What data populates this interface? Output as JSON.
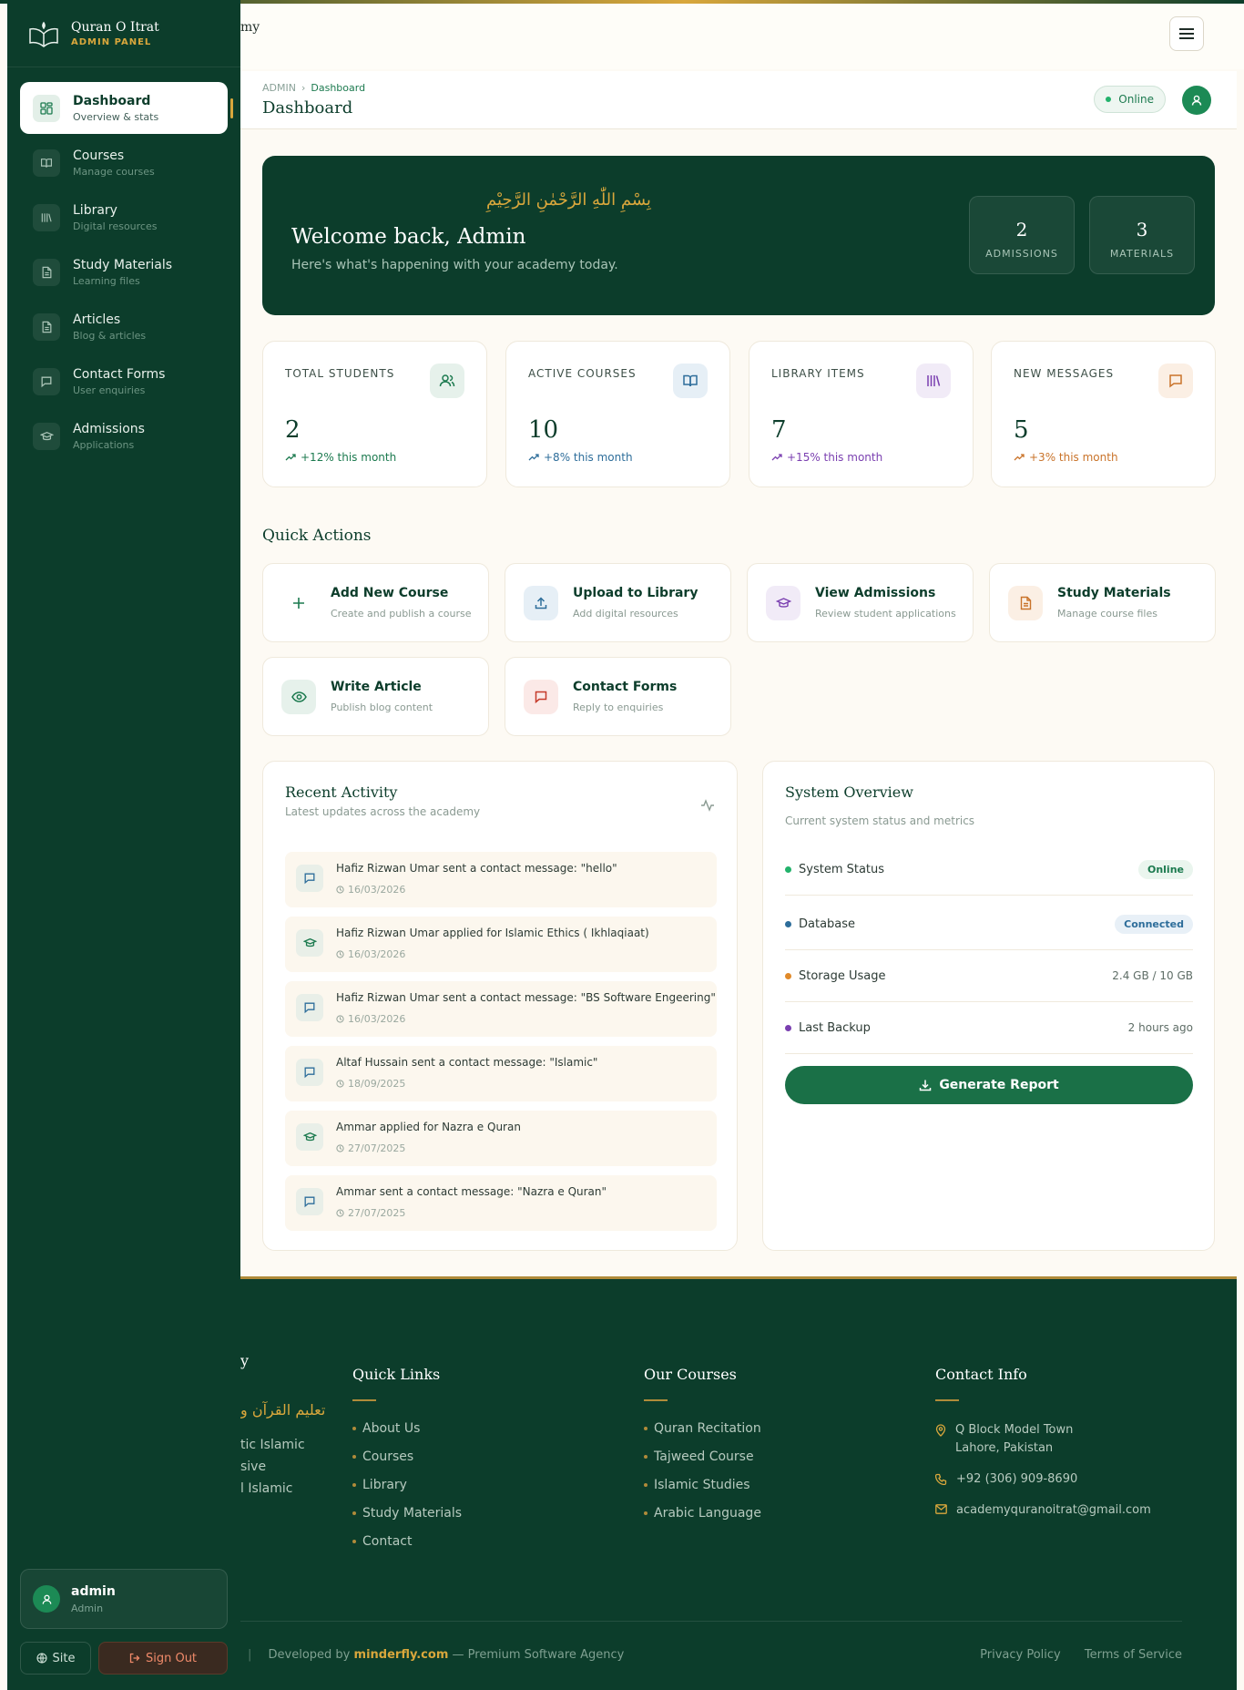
{
  "brand": {
    "name": "Quran O Itrat",
    "sub": "ADMIN PANEL"
  },
  "topbar": {
    "fragment": "my"
  },
  "sidebar": {
    "items": [
      {
        "title": "Dashboard",
        "sub": "Overview & stats",
        "icon": "grid-icon"
      },
      {
        "title": "Courses",
        "sub": "Manage courses",
        "icon": "book-icon"
      },
      {
        "title": "Library",
        "sub": "Digital resources",
        "icon": "library-icon"
      },
      {
        "title": "Study Materials",
        "sub": "Learning files",
        "icon": "file-icon"
      },
      {
        "title": "Articles",
        "sub": "Blog & articles",
        "icon": "file-icon"
      },
      {
        "title": "Contact Forms",
        "sub": "User enquiries",
        "icon": "message-icon"
      },
      {
        "title": "Admissions",
        "sub": "Applications",
        "icon": "graduation-cap-icon"
      }
    ],
    "user": {
      "name": "admin",
      "role": "Admin"
    },
    "site_label": "Site",
    "signout_label": "Sign Out"
  },
  "header": {
    "crumb_root": "ADMIN",
    "crumb_current": "Dashboard",
    "title": "Dashboard",
    "status": "Online"
  },
  "welcome": {
    "arabic": "بِسْمِ اللّٰهِ الرَّحْمٰنِ الرَّحِيْمِ",
    "title": "Welcome back, Admin",
    "subtitle": "Here's what's happening with your academy today.",
    "stats": [
      {
        "value": "2",
        "label": "ADMISSIONS"
      },
      {
        "value": "3",
        "label": "MATERIALS"
      }
    ]
  },
  "stats": [
    {
      "label": "TOTAL STUDENTS",
      "value": "2",
      "trend": "+12% this month",
      "color": "#1c7a4f",
      "bg": "#e6f1eb",
      "icon": "users-icon"
    },
    {
      "label": "ACTIVE COURSES",
      "value": "10",
      "trend": "+8% this month",
      "color": "#2d6d9a",
      "bg": "#e6eff6",
      "icon": "book-icon"
    },
    {
      "label": "LIBRARY ITEMS",
      "value": "7",
      "trend": "+15% this month",
      "color": "#7a3fb0",
      "bg": "#f1ebf7",
      "icon": "library-icon"
    },
    {
      "label": "NEW MESSAGES",
      "value": "5",
      "trend": "+3% this month",
      "color": "#c9732a",
      "bg": "#fbefe4",
      "icon": "message-icon"
    }
  ],
  "quick_actions_title": "Quick Actions",
  "quick_actions": [
    {
      "title": "Add New Course",
      "sub": "Create and publish a course",
      "icon": "plus-icon"
    },
    {
      "title": "Upload to Library",
      "sub": "Add digital resources",
      "icon": "upload-icon"
    },
    {
      "title": "View Admissions",
      "sub": "Review student applications",
      "icon": "graduation-cap-icon"
    },
    {
      "title": "Study Materials",
      "sub": "Manage course files",
      "icon": "file-icon"
    },
    {
      "title": "Write Article",
      "sub": "Publish blog content",
      "icon": "eye-icon"
    },
    {
      "title": "Contact Forms",
      "sub": "Reply to enquiries",
      "icon": "message-icon"
    }
  ],
  "activity": {
    "title": "Recent Activity",
    "subtitle": "Latest updates across the academy",
    "items": [
      {
        "text": "Hafiz Rizwan Umar sent a contact message: \"hello\"",
        "date": "16/03/2026",
        "icon": "message-icon"
      },
      {
        "text": "Hafiz Rizwan Umar applied for Islamic Ethics ( Ikhlaqiaat)",
        "date": "16/03/2026",
        "icon": "graduation-cap-icon"
      },
      {
        "text": "Hafiz Rizwan Umar sent a contact message: \"BS Software Engeering\"",
        "date": "16/03/2026",
        "icon": "message-icon"
      },
      {
        "text": "Altaf Hussain sent a contact message: \"Islamic\"",
        "date": "18/09/2025",
        "icon": "message-icon"
      },
      {
        "text": "Ammar applied for Nazra e Quran",
        "date": "27/07/2025",
        "icon": "graduation-cap-icon"
      },
      {
        "text": "Ammar sent a contact message: \"Nazra e Quran\"",
        "date": "27/07/2025",
        "icon": "message-icon"
      }
    ]
  },
  "system": {
    "title": "System Overview",
    "subtitle": "Current system status and metrics",
    "rows": [
      {
        "label": "System Status",
        "value": "Online",
        "dot": "#22b26b",
        "badge_color": "#1c7a4f",
        "badge_bg": "#eaf5ee"
      },
      {
        "label": "Database",
        "value": "Connected",
        "dot": "#2d6d9a",
        "badge_color": "#2d6d9a",
        "badge_bg": "#e8f0f7"
      },
      {
        "label": "Storage Usage",
        "value": "2.4 GB / 10 GB",
        "dot": "#e08a2a"
      },
      {
        "label": "Last Backup",
        "value": "2 hours ago",
        "dot": "#7a3fb0"
      }
    ],
    "button": "Generate Report"
  },
  "footer": {
    "brand_fragment": "y",
    "arabic_fragment": "تعلیم القرآن و",
    "desc_fragments": [
      "tic Islamic",
      "sive",
      "l Islamic"
    ],
    "quick_links_title": "Quick Links",
    "quick_links": [
      "About Us",
      "Courses",
      "Library",
      "Study Materials",
      "Contact"
    ],
    "courses_title": "Our Courses",
    "courses": [
      "Quran Recitation",
      "Tajweed Course",
      "Islamic Studies",
      "Arabic Language"
    ],
    "contact_title": "Contact Info",
    "address_line1": "Q Block Model Town",
    "address_line2": "Lahore, Pakistan",
    "phone": "+92 (306) 909-8690",
    "email": "academyquranoitrat@gmail.com",
    "dev_prefix": "Developed by",
    "dev_link": "minderfly.com",
    "dev_suffix": "— Premium Software Agency",
    "privacy": "Privacy Policy",
    "terms": "Terms of Service"
  }
}
